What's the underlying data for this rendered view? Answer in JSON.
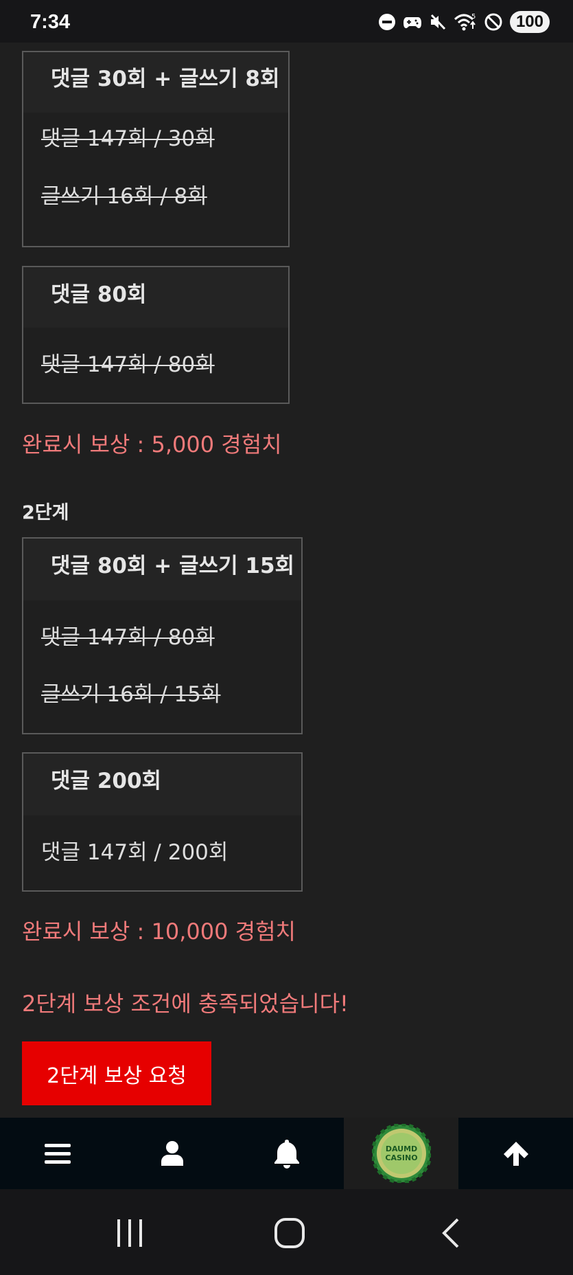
{
  "status_bar": {
    "time": "7:34",
    "battery": "100",
    "icons": [
      "do-not-disturb-icon",
      "gamepad-icon",
      "mute-icon",
      "wifi-icon",
      "blocked-icon",
      "battery-icon"
    ]
  },
  "stage1": {
    "card1": {
      "title": "댓글 30회 + 글쓰기 8회",
      "line1": "댓글 147회 / 30회",
      "line2": "글쓰기 16회 / 8회"
    },
    "card2": {
      "title": "댓글 80회",
      "line1": "댓글 147회 / 80회"
    },
    "reward": "완료시 보상 : 5,000 경험치"
  },
  "stage2": {
    "label": "2단계",
    "card1": {
      "title": "댓글 80회 + 글쓰기 15회",
      "line1": "댓글 147회 / 80회",
      "line2": "글쓰기 16회 / 15회"
    },
    "card2": {
      "title": "댓글 200회",
      "line1": "댓글 147회 / 200회"
    },
    "reward": "완료시 보상 : 10,000 경험치",
    "notice": "2단계 보상 조건에 충족되었습니다!",
    "request_button": "2단계 보상 요청"
  },
  "bottom_nav": {
    "items": [
      "menu-icon",
      "user-icon",
      "bell-icon",
      "casino-logo",
      "arrow-up-icon"
    ],
    "logo_text_1": "DAUMD",
    "logo_text_2": "CASINO"
  },
  "android_nav": [
    "recent-apps-icon",
    "home-icon",
    "back-icon"
  ],
  "colors": {
    "background": "#1f1f1f",
    "reward_text": "#f07a7a",
    "request_button": "#e60000",
    "bottom_nav": "#030c12"
  }
}
